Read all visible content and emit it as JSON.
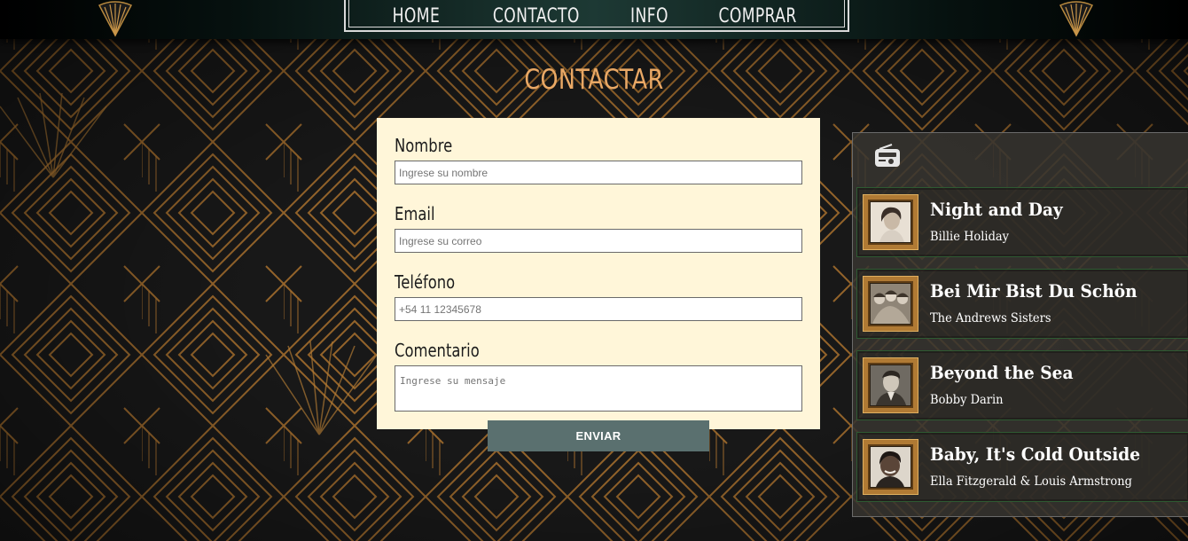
{
  "nav": {
    "items": [
      {
        "label": "HOME"
      },
      {
        "label": "CONTACTO"
      },
      {
        "label": "INFO"
      },
      {
        "label": "COMPRAR"
      }
    ]
  },
  "page": {
    "title": "CONTACTAR"
  },
  "form": {
    "fields": [
      {
        "label": "Nombre",
        "placeholder": "Ingrese su nombre",
        "value": ""
      },
      {
        "label": "Email",
        "placeholder": "Ingrese su correo",
        "value": ""
      },
      {
        "label": "Teléfono",
        "placeholder": "+54 11 12345678",
        "value": ""
      },
      {
        "label": "Comentario",
        "placeholder": "Ingrese su mensaje",
        "value": ""
      }
    ],
    "submit_label": "ENVIAR"
  },
  "player": {
    "icon": "radio-icon",
    "tracks": [
      {
        "title": "Night and Day",
        "artist": "Billie Holiday"
      },
      {
        "title": "Bei Mir Bist Du Schön",
        "artist": "The Andrews Sisters"
      },
      {
        "title": "Beyond the Sea",
        "artist": "Bobby Darin"
      },
      {
        "title": "Baby, It's Cold Outside",
        "artist": "Ella Fitzgerald & Louis Armstrong"
      }
    ]
  },
  "colors": {
    "accent_title": "#e9a865",
    "form_background": "#fff6d9",
    "submit_button": "#5a706f",
    "pattern_gold": "#b07a34"
  }
}
